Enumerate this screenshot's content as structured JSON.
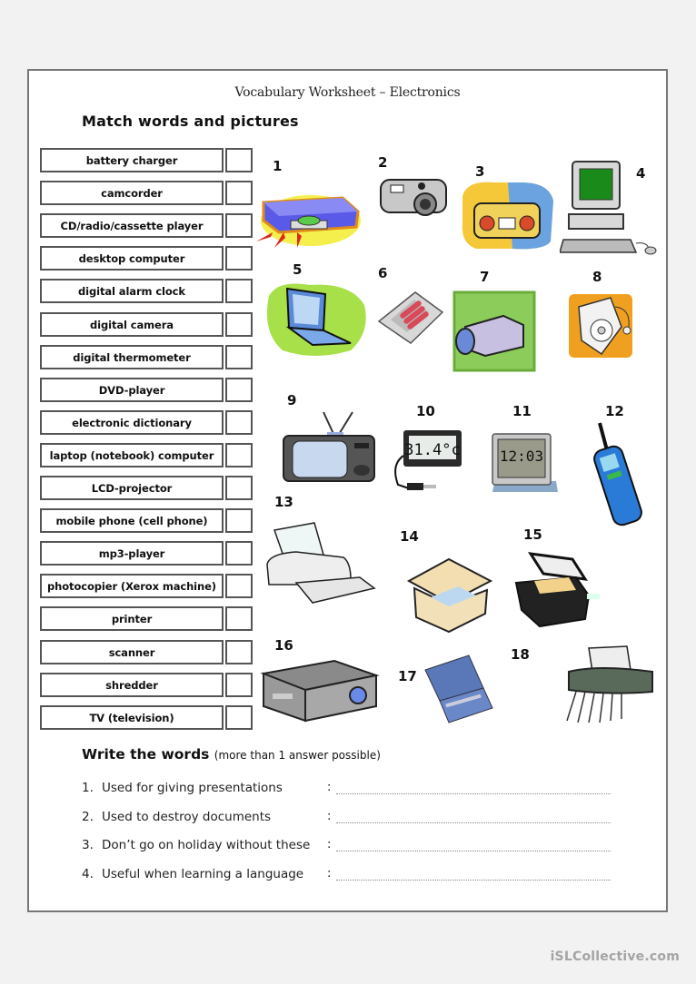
{
  "worksheet": {
    "title": "Vocabulary Worksheet – Electronics",
    "section1_heading": "Match words and pictures",
    "words": [
      "battery charger",
      "camcorder",
      "CD/radio/cassette player",
      "desktop computer",
      "digital alarm clock",
      "digital camera",
      "digital thermometer",
      "DVD-player",
      "electronic dictionary",
      "laptop (notebook) computer",
      "LCD-projector",
      "mobile phone (cell phone)",
      "mp3-player",
      "photocopier (Xerox machine)",
      "printer",
      "scanner",
      "shredder",
      "TV (television)"
    ],
    "pictures": [
      {
        "number": "1",
        "icon": "dvd-player-icon"
      },
      {
        "number": "2",
        "icon": "digital-camera-icon"
      },
      {
        "number": "3",
        "icon": "cd-radio-cassette-icon"
      },
      {
        "number": "4",
        "icon": "desktop-computer-icon"
      },
      {
        "number": "5",
        "icon": "laptop-icon"
      },
      {
        "number": "6",
        "icon": "battery-charger-icon"
      },
      {
        "number": "7",
        "icon": "camcorder-icon"
      },
      {
        "number": "8",
        "icon": "mp3-player-icon"
      },
      {
        "number": "9",
        "icon": "tv-icon"
      },
      {
        "number": "10",
        "icon": "digital-thermometer-icon",
        "display": "31.4°c"
      },
      {
        "number": "11",
        "icon": "digital-alarm-clock-icon",
        "display": "12:03"
      },
      {
        "number": "12",
        "icon": "mobile-phone-icon"
      },
      {
        "number": "13",
        "icon": "printer-icon"
      },
      {
        "number": "14",
        "icon": "scanner-icon"
      },
      {
        "number": "15",
        "icon": "photocopier-icon"
      },
      {
        "number": "16",
        "icon": "lcd-projector-icon"
      },
      {
        "number": "17",
        "icon": "electronic-dictionary-icon"
      },
      {
        "number": "18",
        "icon": "shredder-icon"
      }
    ],
    "section2_heading": "Write the words",
    "section2_note": "(more than 1 answer possible)",
    "questions": [
      {
        "num": "1.",
        "text": "Used for giving presentations",
        "answer": ""
      },
      {
        "num": "2.",
        "text": "Used to destroy documents",
        "answer": ""
      },
      {
        "num": "3.",
        "text": "Don’t go on holiday without these",
        "answer": ""
      },
      {
        "num": "4.",
        "text": "Useful when learning a language",
        "answer": ""
      }
    ],
    "colon": ":"
  },
  "footer": {
    "watermark": "iSLCollective.com"
  },
  "colors": {
    "border": "#555555",
    "page_frame": "#777777",
    "watermark": "#a4a4a4"
  }
}
